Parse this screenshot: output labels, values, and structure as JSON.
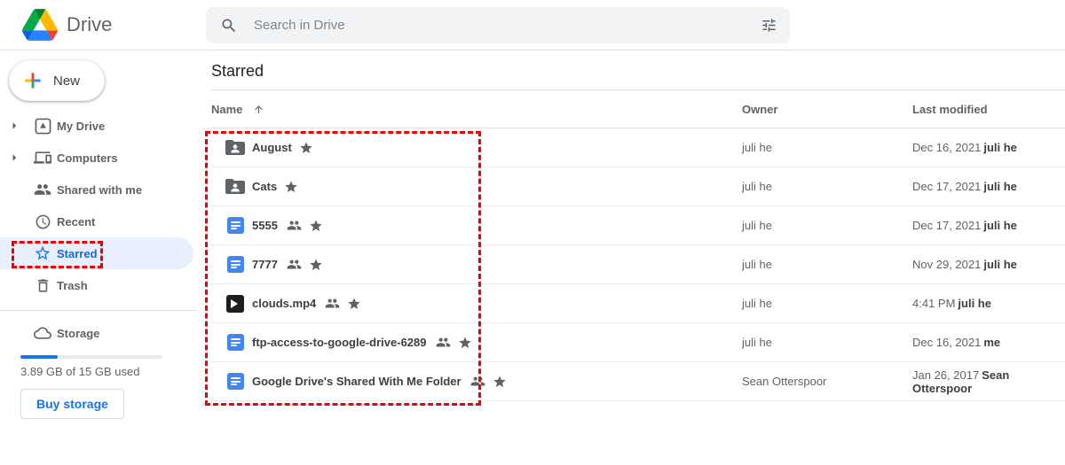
{
  "topbar": {
    "app_name": "Drive",
    "search_placeholder": "Search in Drive"
  },
  "sidebar": {
    "new_button_label": "New",
    "items": [
      {
        "label": "My Drive",
        "icon": "my-drive-icon",
        "expandable": true,
        "active": false
      },
      {
        "label": "Computers",
        "icon": "computers-icon",
        "expandable": true,
        "active": false
      },
      {
        "label": "Shared with me",
        "icon": "shared-with-me-icon",
        "expandable": false,
        "active": false
      },
      {
        "label": "Recent",
        "icon": "recent-icon",
        "expandable": false,
        "active": false
      },
      {
        "label": "Starred",
        "icon": "star-outline-icon",
        "expandable": false,
        "active": true
      },
      {
        "label": "Trash",
        "icon": "trash-icon",
        "expandable": false,
        "active": false
      }
    ],
    "storage": {
      "label": "Storage",
      "icon": "cloud-icon",
      "usage_text": "3.89 GB of 15 GB used",
      "used": "3.89 GB",
      "total": "15 GB",
      "percent_used": 26,
      "buy_button_label": "Buy storage"
    }
  },
  "main": {
    "title": "Starred",
    "table": {
      "columns": {
        "name": "Name",
        "owner": "Owner",
        "last_modified": "Last modified"
      },
      "sort": {
        "column": "Name",
        "direction": "ascending"
      },
      "rows": [
        {
          "name": "August",
          "type": "shared-folder",
          "shared": false,
          "starred": true,
          "owner": "juli he",
          "modified_date": "Dec 16, 2021",
          "modified_by": "juli he"
        },
        {
          "name": "Cats",
          "type": "shared-folder",
          "shared": false,
          "starred": true,
          "owner": "juli he",
          "modified_date": "Dec 17, 2021",
          "modified_by": "juli he"
        },
        {
          "name": "5555",
          "type": "google-doc",
          "shared": true,
          "starred": true,
          "owner": "juli he",
          "modified_date": "Dec 17, 2021",
          "modified_by": "juli he"
        },
        {
          "name": "7777",
          "type": "google-doc",
          "shared": true,
          "starred": true,
          "owner": "juli he",
          "modified_date": "Nov 29, 2021",
          "modified_by": "juli he"
        },
        {
          "name": "clouds.mp4",
          "type": "video",
          "shared": true,
          "starred": true,
          "owner": "juli he",
          "modified_date": "4:41 PM",
          "modified_by": "juli he"
        },
        {
          "name": "ftp-access-to-google-drive-6289",
          "type": "google-doc",
          "shared": true,
          "starred": true,
          "owner": "juli he",
          "modified_date": "Dec 16, 2021",
          "modified_by": "me"
        },
        {
          "name": "Google Drive's Shared With Me Folder",
          "type": "google-doc",
          "shared": true,
          "starred": true,
          "owner": "Sean Otterspoor",
          "modified_date": "Jan 26, 2017",
          "modified_by": "Sean Otterspoor"
        }
      ]
    }
  },
  "annotations": {
    "color": "#ee0000",
    "boxes": [
      "starred-file-list",
      "sidebar-starred-item"
    ]
  },
  "colors": {
    "active_item_bg": "#e8f0fe",
    "active_item_text": "#1967d2",
    "accent_blue": "#1a73e8",
    "doc_icon_blue": "#4285f4",
    "icon_gray": "#5f6368",
    "search_bg": "#f1f3f4"
  }
}
